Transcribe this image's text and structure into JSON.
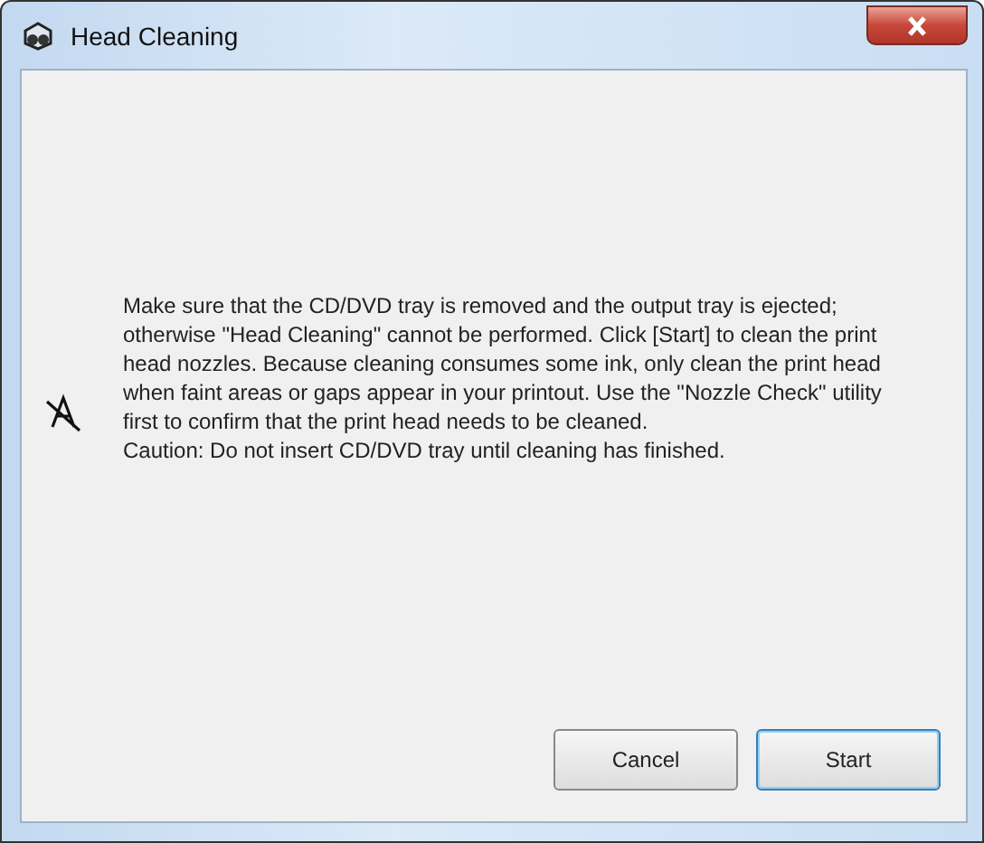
{
  "window": {
    "title": "Head Cleaning"
  },
  "message": {
    "text": "Make sure that the CD/DVD tray is removed and the output tray is ejected; otherwise \"Head Cleaning\" cannot be performed. Click [Start] to clean the print head nozzles. Because cleaning consumes some ink, only clean the print head when faint areas or gaps appear in your printout. Use the \"Nozzle Check\" utility first to confirm that the print head needs to be cleaned.",
    "caution": "Caution: Do not insert CD/DVD tray until cleaning has finished."
  },
  "buttons": [
    {
      "label": "Cancel",
      "selected": false
    },
    {
      "label": "Start",
      "selected": true
    }
  ]
}
